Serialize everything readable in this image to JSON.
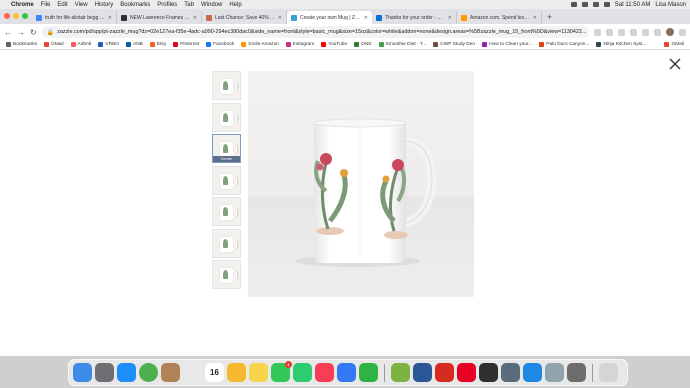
{
  "menubar": {
    "items": [
      "Chrome",
      "File",
      "Edit",
      "View",
      "History",
      "Bookmarks",
      "Profiles",
      "Tab",
      "Window",
      "Help"
    ],
    "clock": "Sat 11:50 AM",
    "user": "Lisa Mason"
  },
  "tabs": [
    {
      "title": "truth for life alistair begg - Se",
      "color": "#4285f4"
    },
    {
      "title": "NEW Lawrence Frames 5x7 S",
      "color": "#2f2f2f"
    },
    {
      "title": "Last Chance: Save 40% on Flo",
      "color": "#c96b4a"
    },
    {
      "title": "Create your own Mug | Zazzl",
      "color": "#37a0d8",
      "active": true
    },
    {
      "title": "Thanks for your order - Walm",
      "color": "#0071ce"
    },
    {
      "title": "Amazon.com. Spend less. Smi",
      "color": "#ff9900"
    }
  ],
  "new_tab_label": "+",
  "toolbar": {
    "back_icon": "←",
    "forward_icon": "→",
    "reload_icon": "↻",
    "url": "zazzle.com/pd/spp/pt-zazzle_mug?dz=02e127ea-f35e-4adc-a990-294ec380dac0&side_name=front&style=basic_mug&size=15oz&color=white&addon=none&design.areas=%5Bzazzle_mug_15_front%5D&view=1130422..."
  },
  "bookmarks": [
    {
      "label": "Bookmarks",
      "color": "#5f6368"
    },
    {
      "label": "GMail",
      "color": "#ea4335"
    },
    {
      "label": "Airbnb",
      "color": "#ff5a5f"
    },
    {
      "label": "VRBO",
      "color": "#245abc"
    },
    {
      "label": "ANB",
      "color": "#0b5ea8"
    },
    {
      "label": "Etsy",
      "color": "#f1641e"
    },
    {
      "label": "Pinterest",
      "color": "#e60023"
    },
    {
      "label": "Facebook",
      "color": "#1877f2"
    },
    {
      "label": "Smile Amazon",
      "color": "#ff9900"
    },
    {
      "label": "Instagram",
      "color": "#c13584"
    },
    {
      "label": "YouTube",
      "color": "#ff0000"
    },
    {
      "label": "ONE",
      "color": "#2e7d32"
    },
    {
      "label": "Smoothie Diet - T...",
      "color": "#43a047"
    },
    {
      "label": "CWP Study Den",
      "color": "#6d4c41"
    },
    {
      "label": "How to Clean your...",
      "color": "#8e24aa"
    },
    {
      "label": "Palo Duro Canyon...",
      "color": "#d84315"
    },
    {
      "label": "Ninja Kitchen Syst...",
      "color": "#37474f"
    },
    {
      "label": "GMail",
      "color": "#ea4335"
    }
  ],
  "viewer": {
    "close_icon": "close-icon",
    "thumbnails": [
      {
        "label": ""
      },
      {
        "label": ""
      },
      {
        "label": "Center",
        "selected": true
      },
      {
        "label": ""
      },
      {
        "label": ""
      },
      {
        "label": ""
      },
      {
        "label": ""
      }
    ]
  },
  "dock": {
    "calendar_day": "16",
    "apps": [
      {
        "name": "finder",
        "color": "#3d8be6"
      },
      {
        "name": "system-preferences",
        "color": "#6e6e73"
      },
      {
        "name": "app-store",
        "color": "#1c8ef9"
      },
      {
        "name": "chrome",
        "color": "#4caf50"
      },
      {
        "name": "contacts",
        "color": "#b08357"
      },
      {
        "name": "launchpad",
        "color": "#e9e9e9"
      },
      {
        "name": "calendar",
        "color": "#ffffff"
      },
      {
        "name": "photos",
        "color": "#f5b82e"
      },
      {
        "name": "notes",
        "color": "#f7d44c"
      },
      {
        "name": "messages",
        "color": "#34c759",
        "badge": "1"
      },
      {
        "name": "facetime",
        "color": "#2ecc71"
      },
      {
        "name": "music",
        "color": "#fa3d56"
      },
      {
        "name": "keynote",
        "color": "#3478f6"
      },
      {
        "name": "numbers",
        "color": "#2fb344"
      },
      {
        "name": "walmart",
        "color": "#7cb342"
      },
      {
        "name": "word",
        "color": "#2b5797"
      },
      {
        "name": "acrobat",
        "color": "#d62b1f"
      },
      {
        "name": "pinterest",
        "color": "#e60023"
      },
      {
        "name": "cricut",
        "color": "#2f2f2f"
      },
      {
        "name": "pen-tool",
        "color": "#5a6b7b"
      },
      {
        "name": "safari",
        "color": "#1e88e5"
      },
      {
        "name": "preview",
        "color": "#90a4ae"
      },
      {
        "name": "script-editor",
        "color": "#6d6d6d"
      },
      {
        "name": "trash",
        "color": "#d5d5d5"
      }
    ]
  }
}
